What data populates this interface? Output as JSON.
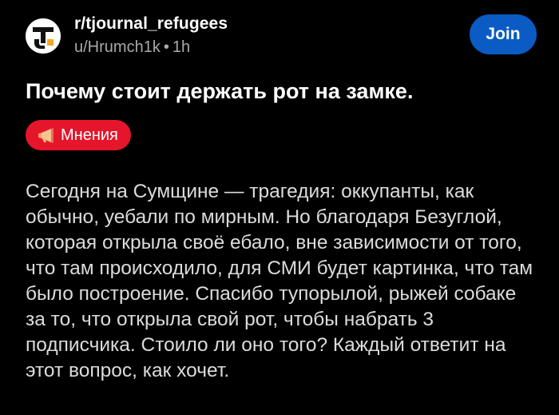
{
  "header": {
    "subreddit": "r/tjournal_refugees",
    "author": "u/Hrumch1k",
    "separator": "•",
    "time": "1h",
    "join_label": "Join"
  },
  "post": {
    "title": "Почему стоит держать рот на замке.",
    "flair": {
      "icon": "megaphone-icon",
      "label": "Мнения"
    },
    "body": "Сегодня на Сумщине — трагедия: оккупанты, как обычно, уебали по мирным. Но благодаря Безуглой, которая открыла своё ебало, вне зависимости от того, что там происходило, для СМИ будет картинка, что там было построение. Спасибо тупорылой, рыжей собаке за то, что открыла свой рот, чтобы набрать 3 подписчика. Стоило ли оно того? Каждый ответит на этот вопрос, как хочет."
  },
  "colors": {
    "background": "#000000",
    "join_button": "#0a5bc4",
    "flair": "#e5152b",
    "muted_text": "#a8aaab",
    "logo_orange": "#f5a623"
  }
}
